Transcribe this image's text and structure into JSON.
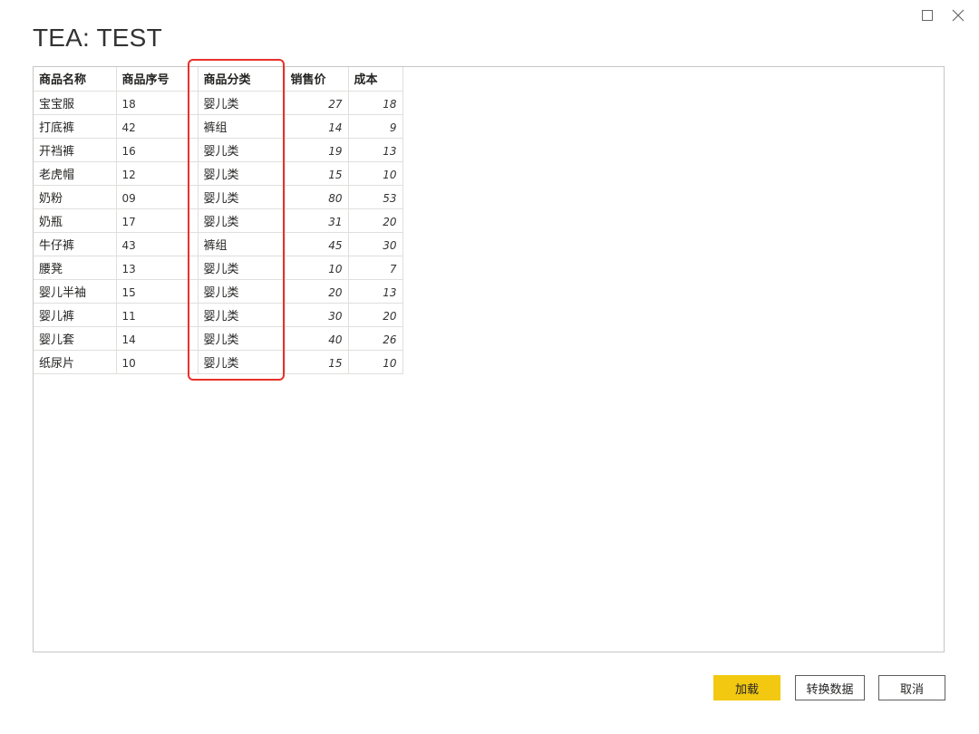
{
  "window": {
    "title": "TEA: TEST",
    "maximize_icon": "□",
    "close_icon": "✕"
  },
  "table": {
    "columns": [
      "商品名称",
      "商品序号",
      "商品分类",
      "销售价",
      "成本"
    ],
    "rows": [
      [
        "宝宝服",
        "18",
        "婴儿类",
        "27",
        "18"
      ],
      [
        "打底裤",
        "42",
        "裤组",
        "14",
        "9"
      ],
      [
        "开裆裤",
        "16",
        "婴儿类",
        "19",
        "13"
      ],
      [
        "老虎帽",
        "12",
        "婴儿类",
        "15",
        "10"
      ],
      [
        "奶粉",
        "09",
        "婴儿类",
        "80",
        "53"
      ],
      [
        "奶瓶",
        "17",
        "婴儿类",
        "31",
        "20"
      ],
      [
        "牛仔裤",
        "43",
        "裤组",
        "45",
        "30"
      ],
      [
        "腰凳",
        "13",
        "婴儿类",
        "10",
        "7"
      ],
      [
        "婴儿半袖",
        "15",
        "婴儿类",
        "20",
        "13"
      ],
      [
        "婴儿裤",
        "11",
        "婴儿类",
        "30",
        "20"
      ],
      [
        "婴儿套",
        "14",
        "婴儿类",
        "40",
        "26"
      ],
      [
        "纸尿片",
        "10",
        "婴儿类",
        "15",
        "10"
      ]
    ],
    "highlight_color": "#e8312a"
  },
  "buttons": {
    "load": "加载",
    "transform": "转换数据",
    "cancel": "取消",
    "load_color": "#f2c811"
  }
}
